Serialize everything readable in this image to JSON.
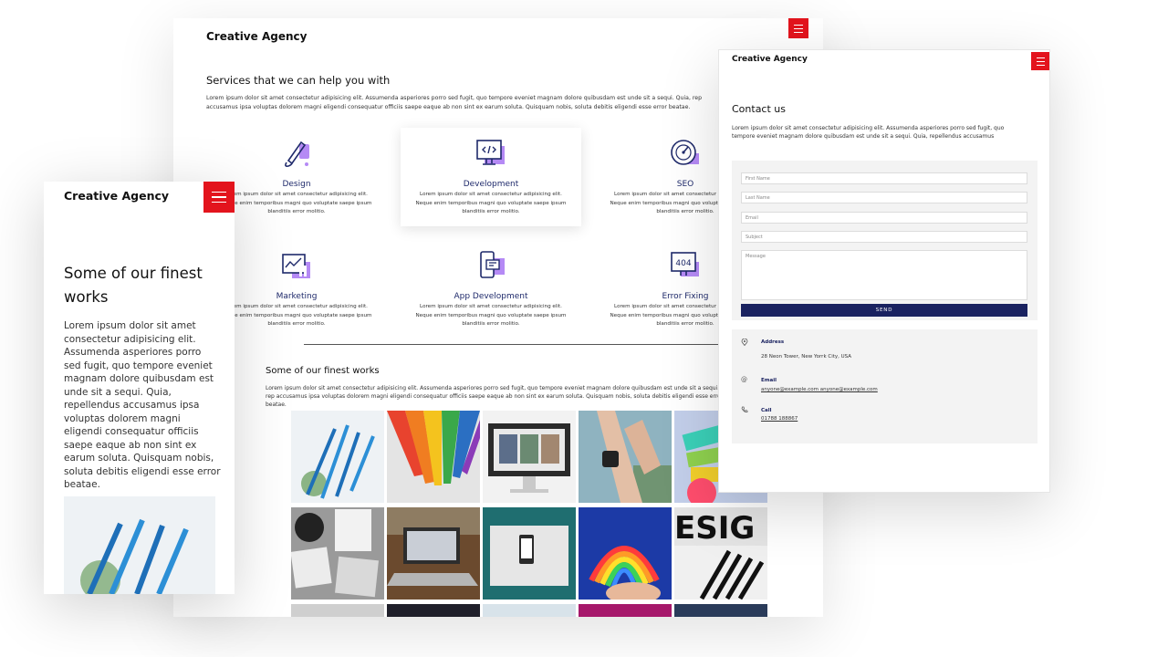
{
  "main": {
    "brand": "Creative Agency",
    "services_title": "Services that we can help you with",
    "services_desc": "Lorem ipsum dolor sit amet consectetur adipisicing elit. Assumenda asperiores porro sed fugit, quo tempore eveniet magnam dolore quibusdam est unde sit a sequi. Quia, rep accusamus ipsa voluptas dolorem magni eligendi consequatur officiis saepe eaque ab non sint ex earum soluta. Quisquam nobis, soluta debitis eligendi esse error beatae.",
    "services": [
      {
        "name": "Design",
        "icon": "brush-icon",
        "desc": "Lorem ipsum dolor sit amet consectetur adipisicing elit. Neque enim temporibus magni quo voluptate saepe ipsum blanditiis error molitio."
      },
      {
        "name": "Development",
        "icon": "code-monitor-icon",
        "desc": "Lorem ipsum dolor sit amet consectetur adipisicing elit. Neque enim temporibus magni quo voluptate saepe ipsum blanditiis error molitio."
      },
      {
        "name": "SEO",
        "icon": "speedometer-icon",
        "desc": "Lorem ipsum dolor sit amet consectetur adipisicing elit. Neque enim temporibus magni quo voluptate saepe ipsum blanditiis error molitio."
      },
      {
        "name": "Marketing",
        "icon": "analytics-chart-icon",
        "desc": "Lorem ipsum dolor sit amet consectetur adipisicing elit. Neque enim temporibus magni quo voluptate saepe ipsum blanditiis error molitio."
      },
      {
        "name": "App Development",
        "icon": "mobile-app-icon",
        "desc": "Lorem ipsum dolor sit amet consectetur adipisicing elit. Neque enim temporibus magni quo voluptate saepe ipsum blanditiis error molitio."
      },
      {
        "name": "Error Fixing",
        "icon": "error-404-icon",
        "desc": "Lorem ipsum dolor sit amet consectetur adipisicing elit. Neque enim temporibus magni quo voluptate saepe ipsum blanditiis error molitio."
      }
    ],
    "works_title": "Some of our finest works",
    "works_desc": "Lorem ipsum dolor sit amet consectetur adipisicing elit. Assumenda asperiores porro sed fugit, quo tempore eveniet magnam dolore quibusdam est unde sit a sequi. Quia, rep accusamus ipsa voluptas dolorem magni eligendi consequatur officiis saepe eaque ab non sint ex earum soluta. Quisquam nobis, soluta debitis eligendi esse error beatae.",
    "gallery": [
      {
        "name": "blue-pencils-photo",
        "bg": "#e9eef3",
        "accent": "#1f6fb5"
      },
      {
        "name": "colored-pencils-photo",
        "bg": "#d9d9d9",
        "accent": "#e8432e"
      },
      {
        "name": "imac-desk-photo",
        "bg": "#f2f2f2",
        "accent": "#2b2b2b"
      },
      {
        "name": "smartwatch-wrist-photo",
        "bg": "#7aa9b8",
        "accent": "#d8b29a"
      },
      {
        "name": "colorful-clay-photo",
        "bg": "#b8c8e6",
        "accent": "#3bd0b8"
      },
      {
        "name": "creative-mess-photo",
        "bg": "#8a8a8a",
        "accent": "#111111"
      },
      {
        "name": "laptop-workspace-photo",
        "bg": "#6b4a2e",
        "accent": "#c9ced6"
      },
      {
        "name": "phone-on-desk-photo",
        "bg": "#1f7a7a",
        "accent": "#e9e9e9"
      },
      {
        "name": "rainbow-clay-photo",
        "bg": "#1d3ea8",
        "accent": "#ff3b3b"
      },
      {
        "name": "design-black-pencils-photo",
        "bg": "#e8e8e8",
        "accent": "#111111"
      }
    ]
  },
  "contact": {
    "brand": "Creative Agency",
    "title": "Contact us",
    "desc": "Lorem ipsum dolor sit amet consectetur adipisicing elit. Assumenda asperiores porro sed fugit, quo tempore eveniet magnam dolore quibusdam est unde sit a sequi. Quia, repellendus accusamus",
    "fields": {
      "first_name": "First Name",
      "last_name": "Last Name",
      "email": "Email",
      "subject": "Subject",
      "message": "Message"
    },
    "send_label": "SEND",
    "address_label": "Address",
    "address_value": "28 Neon Tower, New Yorrk City, USA",
    "email_label": "Email",
    "email_value": "anyone@example.com anyone@example.com",
    "call_label": "Call",
    "call_value": "01788 188867"
  },
  "mobile": {
    "brand": "Creative Agency",
    "title": "Some of our finest works",
    "desc": "Lorem ipsum dolor sit amet consectetur adipisicing elit. Assumenda asperiores porro sed fugit, quo tempore eveniet magnam dolore quibusdam est unde sit a sequi. Quia, repellendus accusamus ipsa voluptas dolorem magni eligendi consequatur officiis saepe eaque ab non sint ex earum soluta. Quisquam nobis, soluta debitis eligendi esse error beatae."
  },
  "colors": {
    "accent_red": "#e3141d",
    "navy": "#1a2260",
    "icon_purple": "#9b6cf0"
  }
}
